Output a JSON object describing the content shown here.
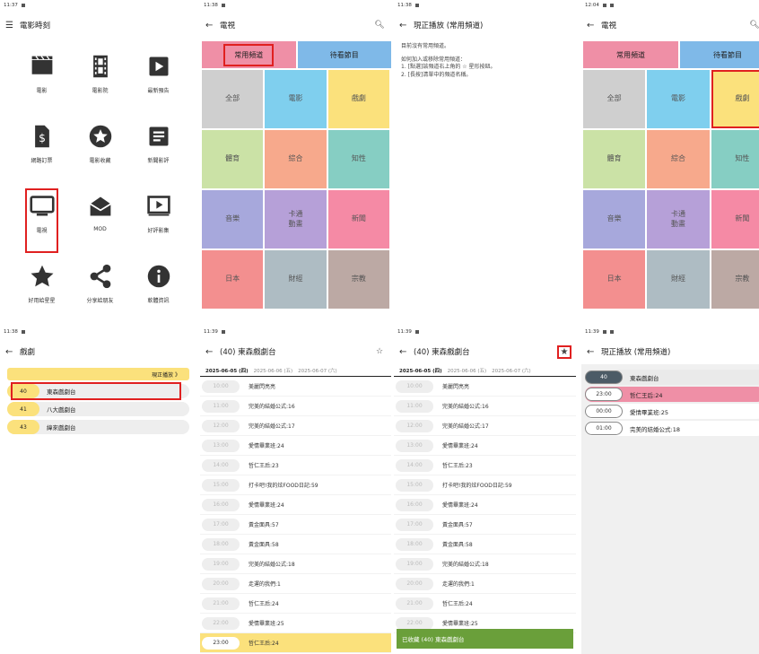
{
  "screen1": {
    "status": "11:37",
    "title": "電影時刻",
    "items": [
      {
        "icon": "clapper-icon",
        "label": "電影"
      },
      {
        "icon": "film-strip-icon",
        "label": "電影院"
      },
      {
        "icon": "play-icon",
        "label": "最新預告"
      },
      {
        "icon": "ticket-dollar-icon",
        "label": "網路訂票"
      },
      {
        "icon": "star-circle-icon",
        "label": "電影收藏"
      },
      {
        "icon": "article-icon",
        "label": "新聞影評"
      },
      {
        "icon": "tv-icon",
        "label": "電視"
      },
      {
        "icon": "mail-open-icon",
        "label": "MOD"
      },
      {
        "icon": "video-icon",
        "label": "好評影集"
      },
      {
        "icon": "star-icon",
        "label": "好用給星星"
      },
      {
        "icon": "share-icon",
        "label": "分享給朋友"
      },
      {
        "icon": "info-icon",
        "label": "軟體資訊"
      }
    ]
  },
  "screen2": {
    "status": "11:38",
    "title": "電視",
    "tab_common": "常用頻道",
    "tab_watch": "待看節目",
    "categories": [
      "全部",
      "電影",
      "戲劇",
      "體育",
      "綜合",
      "知性",
      "音樂",
      "卡通\n動畫",
      "新聞",
      "日本",
      "財經",
      "宗教"
    ]
  },
  "screen3": {
    "status": "11:38",
    "title": "現正播放 (常用頻道)",
    "msg1": "目前沒有常用頻道。",
    "msg2": "如何加入或移除常用頻道：",
    "msg3": "1. [點選]該頻道右上角的 ☆ 星形按鈕。",
    "msg4": "2. [長按]清單中的頻道名稱。"
  },
  "screen4": {
    "status": "12:04",
    "title": "電視",
    "tab_common": "常用頻道",
    "tab_watch": "待看節目",
    "categories": [
      "全部",
      "電影",
      "戲劇",
      "體育",
      "綜合",
      "知性",
      "音樂",
      "卡通\n動畫",
      "新聞",
      "日本",
      "財經",
      "宗教"
    ]
  },
  "screen5": {
    "status": "11:38",
    "title": "戲劇",
    "now_playing": "現正播放 》",
    "channels": [
      {
        "num": "40",
        "name": "東森戲劇台"
      },
      {
        "num": "41",
        "name": "八大戲劇台"
      },
      {
        "num": "43",
        "name": "緯來戲劇台"
      }
    ]
  },
  "screen6": {
    "status": "11:39",
    "title": "(40) 東森戲劇台",
    "dates": [
      "2025-06-05 (四)",
      "2025-06-06 (五)",
      "2025-06-07 (六)"
    ],
    "programs": [
      {
        "t": "10:00",
        "n": "美麗閃亮亮"
      },
      {
        "t": "11:00",
        "n": "完美的結婚公式:16"
      },
      {
        "t": "12:00",
        "n": "完美的結婚公式:17"
      },
      {
        "t": "13:00",
        "n": "愛情畢業班:24"
      },
      {
        "t": "14:00",
        "n": "哲仁王后:23"
      },
      {
        "t": "15:00",
        "n": "打卡吧!我的炫FOOD日記:59"
      },
      {
        "t": "16:00",
        "n": "愛情畢業班:24"
      },
      {
        "t": "17:00",
        "n": "黃金面具:57"
      },
      {
        "t": "18:00",
        "n": "黃金面具:58"
      },
      {
        "t": "19:00",
        "n": "完美的結婚公式:18"
      },
      {
        "t": "20:00",
        "n": "走運的我們:1"
      },
      {
        "t": "21:00",
        "n": "哲仁王后:24"
      },
      {
        "t": "22:00",
        "n": "愛情畢業班:25"
      },
      {
        "t": "23:00",
        "n": "哲仁王后:24"
      }
    ]
  },
  "screen7": {
    "status": "11:39",
    "title": "(40) 東森戲劇台",
    "toast": "已收藏 (40) 東森戲劇台"
  },
  "screen8": {
    "status": "11:39",
    "title": "現正播放 (常用頻道)",
    "favs": [
      {
        "p": "40",
        "n": "東森戲劇台"
      },
      {
        "p": "23:00",
        "n": "哲仁王后:24"
      },
      {
        "p": "00:00",
        "n": "愛情畢業班:25"
      },
      {
        "p": "01:00",
        "n": "完美的結婚公式:18"
      }
    ]
  }
}
